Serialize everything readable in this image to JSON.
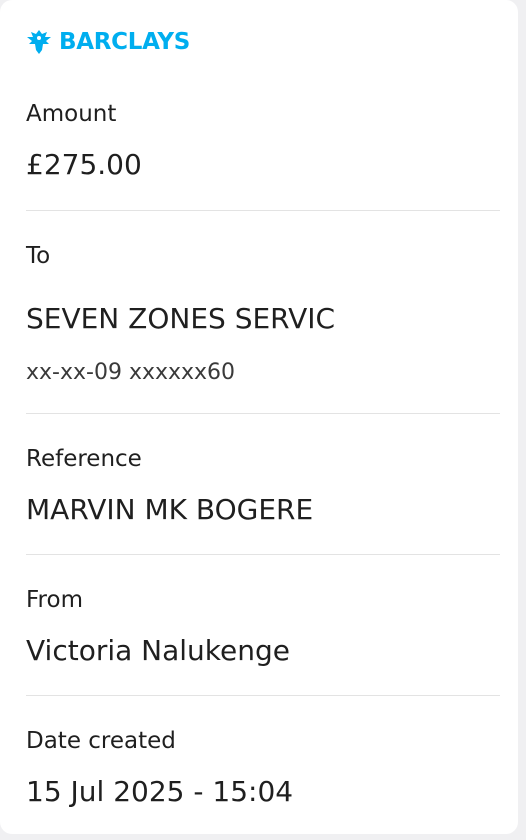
{
  "brand": {
    "name": "BARCLAYS",
    "color": "#00aeef",
    "logo_icon": "eagle-icon"
  },
  "details": {
    "amount": {
      "label": "Amount",
      "value": "£275.00"
    },
    "to": {
      "label": "To",
      "payee": "SEVEN ZONES SERVIC",
      "account": "xx-xx-09 xxxxxx60"
    },
    "reference": {
      "label": "Reference",
      "value": "MARVIN MK BOGERE"
    },
    "from": {
      "label": "From",
      "value": "Victoria Nalukenge"
    },
    "date_created": {
      "label": "Date created",
      "value": "15 Jul 2025 - 15:04"
    }
  }
}
